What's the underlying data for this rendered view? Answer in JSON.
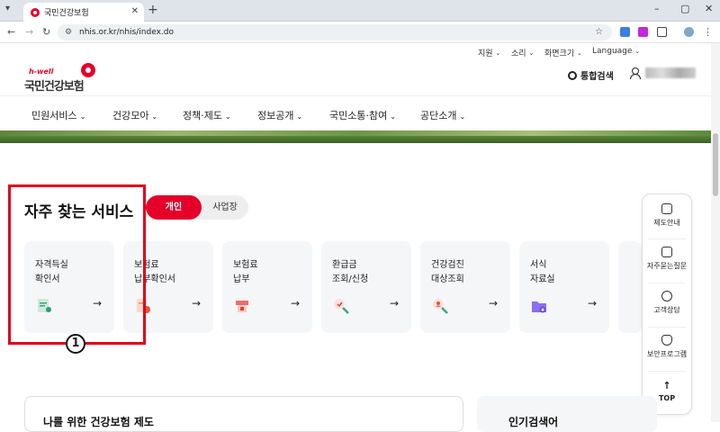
{
  "browser": {
    "tab_title": "국민건강보험",
    "new_tab": "+",
    "url": "nhis.or.kr/nhis/index.do",
    "window_controls": [
      "–",
      "▢",
      "✕"
    ]
  },
  "util_nav": {
    "items": [
      "지원",
      "소리",
      "화면크기",
      "Language"
    ]
  },
  "logo": {
    "en": "h-well",
    "ko": "국민건강보험"
  },
  "header": {
    "search_label": "통합검색"
  },
  "main_menu": [
    "민원서비스",
    "건강모아",
    "정책·제도",
    "정보공개",
    "국민소통·참여",
    "공단소개"
  ],
  "services": {
    "title": "자주 찾는 서비스",
    "toggle_on": "개인",
    "toggle_off": "사업장",
    "cards": [
      {
        "label": "자격득실\n확인서",
        "icon": "certificate-icon"
      },
      {
        "label": "보험료\n납부확인서",
        "icon": "receipt-icon"
      },
      {
        "label": "보험료\n납부",
        "icon": "payment-icon"
      },
      {
        "label": "환급금\n조회/신청",
        "icon": "refund-search-icon"
      },
      {
        "label": "건강검진\n대상조회",
        "icon": "checkup-search-icon"
      },
      {
        "label": "서식\n자료실",
        "icon": "folder-download-icon"
      }
    ],
    "arrow": "→"
  },
  "annotation": {
    "badge": "1"
  },
  "quick_menu": [
    "제도안내",
    "자주묻는질문",
    "고객상담",
    "보안프로그램",
    "TOP"
  ],
  "bottom": {
    "left_title": "나를 위한 건강보험 제도",
    "right_title": "인기검색어"
  },
  "colors": {
    "brand": "#e5002b",
    "highlight": "#e0001b"
  }
}
